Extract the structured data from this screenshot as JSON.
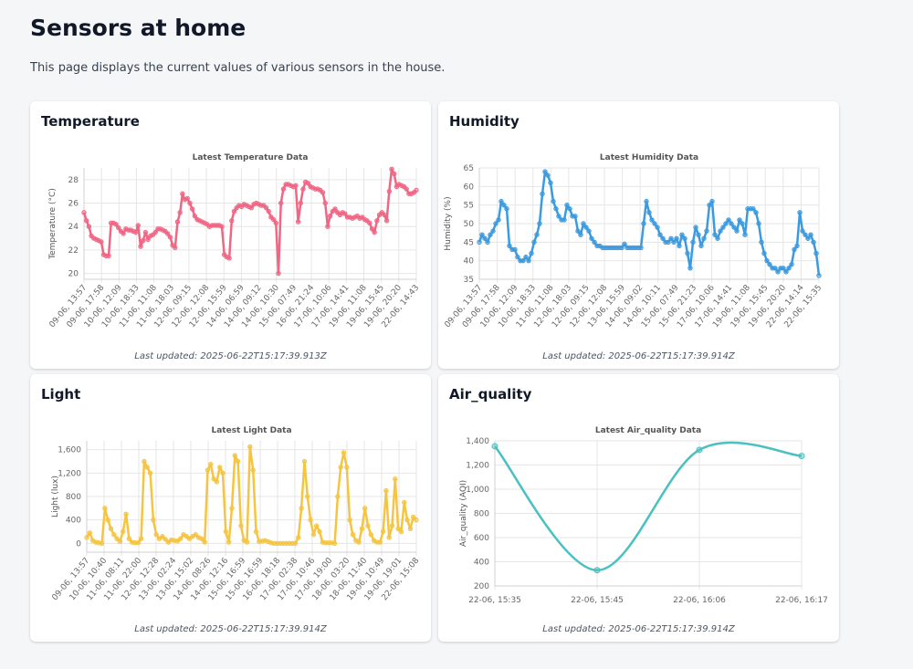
{
  "page": {
    "title": "Sensors at home",
    "description": "This page displays the current values of various sensors in the house."
  },
  "cards": [
    {
      "heading": "Temperature",
      "updated": "Last updated: 2025-06-22T15:17:39.913Z",
      "color": "#f06784",
      "chart_data": {
        "type": "line",
        "title": "Latest Temperature Data",
        "xlabel": "",
        "ylabel": "Temperature (°C)",
        "ylim": [
          19.5,
          29
        ],
        "yticks": [
          "20",
          "22",
          "24",
          "26",
          "28"
        ],
        "ytick_values": [
          20,
          22,
          24,
          26,
          28
        ],
        "x_tick_labels": [
          "09-06, 13:57",
          "09-06, 17:58",
          "10-06, 12:09",
          "10-06, 18:33",
          "11-06, 11:08",
          "11-06, 18:03",
          "12-06, 09:15",
          "12-06, 12:08",
          "12-06, 15:59",
          "14-06, 06:59",
          "14-06, 09:12",
          "14-06, 10:30",
          "15-06, 07:49",
          "16-06, 21:24",
          "17-06, 10:06",
          "17-06, 14:41",
          "19-06, 11:08",
          "19-06, 15:45",
          "19-06, 20:20",
          "22-06, 14:43"
        ],
        "values": [
          25.2,
          24.5,
          24.0,
          23.2,
          23.0,
          22.9,
          22.8,
          22.7,
          21.6,
          21.5,
          21.5,
          24.3,
          24.3,
          24.2,
          23.9,
          23.6,
          23.4,
          23.8,
          23.7,
          23.7,
          23.6,
          23.5,
          24.1,
          22.3,
          22.8,
          23.5,
          22.9,
          23.2,
          23.3,
          23.5,
          23.8,
          23.8,
          23.7,
          23.6,
          23.4,
          23.1,
          22.4,
          22.2,
          24.4,
          25.2,
          26.8,
          26.3,
          26.4,
          26.0,
          25.5,
          24.9,
          24.6,
          24.5,
          24.4,
          24.3,
          24.2,
          24.0,
          24.1,
          24.1,
          24.1,
          24.1,
          24.0,
          21.6,
          21.4,
          21.3,
          24.5,
          25.3,
          25.6,
          25.8,
          25.7,
          25.9,
          25.8,
          25.7,
          25.6,
          25.9,
          26.0,
          25.9,
          25.8,
          25.8,
          25.6,
          25.3,
          24.8,
          24.6,
          24.3,
          20.0,
          26.0,
          27.2,
          27.6,
          27.6,
          27.5,
          27.4,
          27.5,
          24.4,
          26.0,
          27.2,
          27.8,
          27.7,
          27.4,
          27.3,
          27.2,
          27.2,
          27.1,
          26.9,
          26.0,
          24.0,
          24.9,
          25.3,
          25.5,
          25.2,
          25.0,
          25.2,
          25.1,
          24.8,
          24.8,
          24.7,
          24.8,
          24.9,
          24.7,
          24.8,
          24.6,
          24.5,
          24.3,
          23.8,
          23.5,
          24.5,
          25.0,
          25.2,
          25.0,
          24.5,
          27.0,
          28.9,
          28.5,
          27.4,
          27.6,
          27.5,
          27.4,
          27.2,
          26.8,
          26.8,
          26.9,
          27.1
        ]
      }
    },
    {
      "heading": "Humidity",
      "updated": "Last updated: 2025-06-22T15:17:39.914Z",
      "color": "#3b9be0",
      "chart_data": {
        "type": "line",
        "title": "Latest Humidity Data",
        "xlabel": "",
        "ylabel": "Humidity (%)",
        "ylim": [
          35,
          65
        ],
        "yticks": [
          "35",
          "40",
          "45",
          "50",
          "55",
          "60",
          "65"
        ],
        "ytick_values": [
          35,
          40,
          45,
          50,
          55,
          60,
          65
        ],
        "x_tick_labels": [
          "09-06, 13:57",
          "09-06, 17:58",
          "10-06, 12:09",
          "10-06, 18:33",
          "11-06, 11:08",
          "12-06, 18:03",
          "12-06, 09:15",
          "12-06, 12:08",
          "13-06, 15:59",
          "14-06, 09:02",
          "14-06, 10:11",
          "15-06, 07:49",
          "15-06, 21:23",
          "17-06, 10:06",
          "17-06, 14:41",
          "19-06, 11:08",
          "19-06, 15:45",
          "19-06, 20:20",
          "22-06, 14:14",
          "22-06, 15:35"
        ],
        "values": [
          45,
          47,
          46,
          45,
          47,
          48,
          50,
          51,
          56,
          55,
          54,
          44,
          43,
          43,
          41,
          40,
          40,
          41,
          40,
          42,
          45,
          47,
          50,
          58,
          64,
          63,
          61,
          56,
          54,
          52,
          51,
          51,
          55,
          54,
          52,
          52,
          48,
          47,
          50,
          49,
          48,
          46,
          45,
          44,
          44,
          43.5,
          43.5,
          43.5,
          43.5,
          43.5,
          43.5,
          43.5,
          43.5,
          44.5,
          43.5,
          43.5,
          43.5,
          43.5,
          43.5,
          43.5,
          50,
          56,
          53,
          51,
          50,
          49,
          47,
          46,
          45,
          45,
          46,
          45,
          46,
          44,
          47,
          46,
          42,
          38,
          45,
          49,
          47,
          44,
          46,
          48,
          55,
          56,
          47,
          46,
          48,
          49,
          50,
          51,
          50,
          49,
          48,
          51,
          50,
          47,
          54,
          54,
          54,
          53,
          50,
          45,
          42,
          40,
          39,
          38,
          38,
          37,
          38,
          38,
          37,
          38,
          39,
          43,
          44,
          53,
          48,
          47,
          46,
          47,
          45,
          42,
          36
        ]
      }
    },
    {
      "heading": "Light",
      "updated": "Last updated: 2025-06-22T15:17:39.914Z",
      "color": "#f5c542",
      "chart_data": {
        "type": "line",
        "title": "Latest Light Data",
        "xlabel": "",
        "ylabel": "Light (lux)",
        "ylim": [
          -150,
          1750
        ],
        "yticks": [
          "0",
          "400",
          "800",
          "1,200",
          "1,600"
        ],
        "ytick_values": [
          0,
          400,
          800,
          1200,
          1600
        ],
        "x_tick_labels": [
          "09-06, 13:57",
          "10-06, 10:40",
          "11-06, 08:11",
          "11-06, 22:00",
          "12-06, 12:28",
          "13-06, 02:24",
          "13-06, 15:02",
          "14-06, 08:26",
          "14-06, 12:16",
          "15-06, 16:59",
          "15-06, 16:59",
          "16-06, 18:18",
          "17-06, 02:38",
          "17-06, 10:46",
          "17-06, 19:00",
          "18-06, 03:20",
          "18-06, 11:40",
          "19-06, 10:49",
          "19-06, 19:01",
          "22-06, 15:08"
        ],
        "values": [
          100,
          180,
          50,
          20,
          10,
          0,
          600,
          400,
          250,
          150,
          80,
          30,
          200,
          500,
          80,
          20,
          10,
          10,
          80,
          1400,
          1300,
          1200,
          400,
          150,
          80,
          120,
          70,
          20,
          60,
          50,
          40,
          80,
          150,
          120,
          80,
          120,
          150,
          100,
          80,
          20,
          1250,
          1350,
          1100,
          1050,
          1300,
          1200,
          200,
          20,
          600,
          1500,
          1400,
          300,
          50,
          20,
          1650,
          1250,
          200,
          30,
          40,
          50,
          30,
          10,
          0,
          0,
          0,
          0,
          0,
          0,
          0,
          0,
          100,
          600,
          1400,
          800,
          400,
          150,
          300,
          200,
          20,
          10,
          10,
          10,
          0,
          800,
          1300,
          1550,
          1300,
          400,
          150,
          50,
          20,
          250,
          600,
          300,
          150,
          50,
          20,
          20,
          200,
          900,
          100,
          300,
          1100,
          250,
          200,
          700,
          400,
          250,
          450,
          400
        ]
      }
    },
    {
      "heading": "Air_quality",
      "updated": "Last updated: 2025-06-22T15:17:39.914Z",
      "color": "#4bc0c0",
      "chart_data": {
        "type": "line",
        "title": "Latest Air_quality Data",
        "xlabel": "",
        "ylabel": "Air_quality (AQI)",
        "ylim": [
          200,
          1400
        ],
        "yticks": [
          "200",
          "400",
          "600",
          "800",
          "1,000",
          "1,200",
          "1,400"
        ],
        "ytick_values": [
          200,
          400,
          600,
          800,
          1000,
          1200,
          1400
        ],
        "categories": [
          "22-06, 15:35",
          "22-06, 15:45",
          "22-06, 16:06",
          "22-06, 16:17"
        ],
        "values": [
          1355,
          330,
          1325,
          1275
        ]
      }
    }
  ]
}
